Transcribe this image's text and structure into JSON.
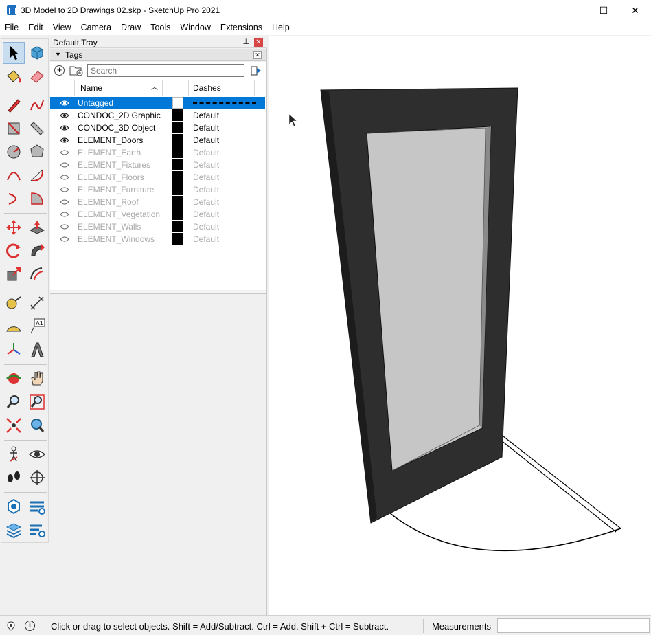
{
  "window": {
    "title": "3D Model to 2D Drawings 02.skp - SketchUp Pro 2021",
    "min": "—",
    "max": "☐",
    "close": "✕"
  },
  "menu": [
    "File",
    "Edit",
    "View",
    "Camera",
    "Draw",
    "Tools",
    "Window",
    "Extensions",
    "Help"
  ],
  "tray": {
    "title": "Default Tray",
    "panel": "Tags",
    "search_placeholder": "Search",
    "columns": {
      "name": "Name",
      "dashes": "Dashes"
    },
    "tags": [
      {
        "name": "Untagged",
        "visible": true,
        "dashes": "",
        "selected": true
      },
      {
        "name": "CONDOC_2D Graphic",
        "visible": true,
        "dashes": "Default"
      },
      {
        "name": "CONDOC_3D Object",
        "visible": true,
        "dashes": "Default"
      },
      {
        "name": "ELEMENT_Doors",
        "visible": true,
        "dashes": "Default"
      },
      {
        "name": "ELEMENT_Earth",
        "visible": false,
        "dashes": "Default"
      },
      {
        "name": "ELEMENT_Fixtures",
        "visible": false,
        "dashes": "Default"
      },
      {
        "name": "ELEMENT_Floors",
        "visible": false,
        "dashes": "Default"
      },
      {
        "name": "ELEMENT_Furniture",
        "visible": false,
        "dashes": "Default"
      },
      {
        "name": "ELEMENT_Roof",
        "visible": false,
        "dashes": "Default"
      },
      {
        "name": "ELEMENT_Vegetation",
        "visible": false,
        "dashes": "Default"
      },
      {
        "name": "ELEMENT_Walls",
        "visible": false,
        "dashes": "Default"
      },
      {
        "name": "ELEMENT_Windows",
        "visible": false,
        "dashes": "Default"
      }
    ]
  },
  "toolbar_text": {
    "text_tool_glyph": "A1"
  },
  "status": {
    "hint": "Click or drag to select objects. Shift = Add/Subtract. Ctrl = Add. Shift + Ctrl = Subtract.",
    "measurements_label": "Measurements",
    "measurements_value": ""
  }
}
